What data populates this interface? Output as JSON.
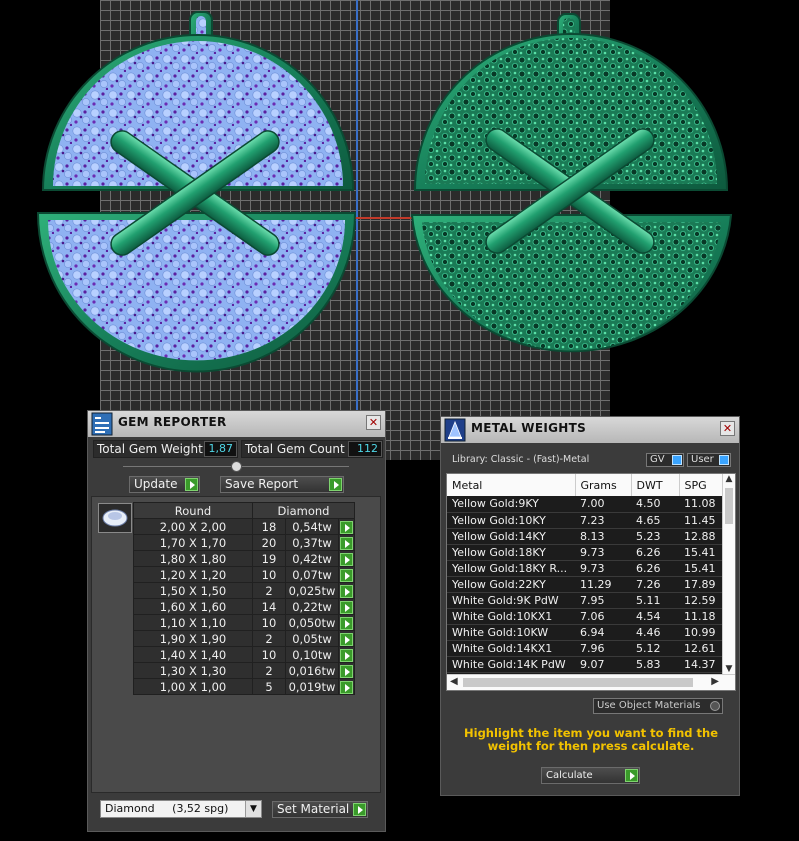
{
  "gem_reporter": {
    "title": "GEM REPORTER",
    "close": "✕",
    "total_gem_weight_label": "Total Gem Weight",
    "total_gem_weight_value": "1,87",
    "total_gem_count_label": "Total Gem Count",
    "total_gem_count_value": "112",
    "update_label": "Update",
    "save_report_label": "Save Report",
    "columns": [
      "Round",
      "Diamond"
    ],
    "rows": [
      {
        "size": "2,00 X 2,00",
        "count": "18",
        "weight": "0,54tw"
      },
      {
        "size": "1,70 X 1,70",
        "count": "20",
        "weight": "0,37tw"
      },
      {
        "size": "1,80 X 1,80",
        "count": "19",
        "weight": "0,42tw"
      },
      {
        "size": "1,20 X 1,20",
        "count": "10",
        "weight": "0,07tw"
      },
      {
        "size": "1,50 X 1,50",
        "count": "2",
        "weight": "0,025tw"
      },
      {
        "size": "1,60 X 1,60",
        "count": "14",
        "weight": "0,22tw"
      },
      {
        "size": "1,10 X 1,10",
        "count": "10",
        "weight": "0,050tw"
      },
      {
        "size": "1,90 X 1,90",
        "count": "2",
        "weight": "0,05tw"
      },
      {
        "size": "1,40 X 1,40",
        "count": "10",
        "weight": "0,10tw"
      },
      {
        "size": "1,30 X 1,30",
        "count": "2",
        "weight": "0,016tw"
      },
      {
        "size": "1,00 X 1,00",
        "count": "5",
        "weight": "0,019tw"
      }
    ],
    "material_select": "Diamond     (3,52 spg)",
    "set_material_label": "Set Material"
  },
  "metal_weights": {
    "title": "METAL WEIGHTS",
    "close": "✕",
    "library_label": "Library: Classic - (Fast)-Metal",
    "gv_label": "GV",
    "user_label": "User",
    "columns": [
      "Metal",
      "Grams",
      "DWT",
      "SPG"
    ],
    "rows": [
      {
        "metal": "Yellow Gold:9KY",
        "grams": "7.00",
        "dwt": "4.50",
        "spg": "11.08"
      },
      {
        "metal": "Yellow Gold:10KY",
        "grams": "7.23",
        "dwt": "4.65",
        "spg": "11.45"
      },
      {
        "metal": "Yellow Gold:14KY",
        "grams": "8.13",
        "dwt": "5.23",
        "spg": "12.88"
      },
      {
        "metal": "Yellow Gold:18KY",
        "grams": "9.73",
        "dwt": "6.26",
        "spg": "15.41"
      },
      {
        "metal": "Yellow Gold:18KY R...",
        "grams": "9.73",
        "dwt": "6.26",
        "spg": "15.41"
      },
      {
        "metal": "Yellow Gold:22KY",
        "grams": "11.29",
        "dwt": "7.26",
        "spg": "17.89"
      },
      {
        "metal": "White Gold:9K PdW",
        "grams": "7.95",
        "dwt": "5.11",
        "spg": "12.59"
      },
      {
        "metal": "White Gold:10KX1",
        "grams": "7.06",
        "dwt": "4.54",
        "spg": "11.18"
      },
      {
        "metal": "White Gold:10KW",
        "grams": "6.94",
        "dwt": "4.46",
        "spg": "10.99"
      },
      {
        "metal": "White Gold:14KX1",
        "grams": "7.96",
        "dwt": "5.12",
        "spg": "12.61"
      },
      {
        "metal": "White Gold:14K PdW",
        "grams": "9.07",
        "dwt": "5.83",
        "spg": "14.37"
      }
    ],
    "use_object_materials_label": "Use Object Materials",
    "hint_text": "Highlight the item you want to find the weight for then press calculate.",
    "calculate_label": "Calculate"
  },
  "colors": {
    "accent_green": "#3a9b2a",
    "value_cyan": "#4fd6e6",
    "hint_yellow": "#f2c200",
    "metal_green": "#1f8a5c",
    "gem_blue": "#8fb6ff",
    "gem_purple": "#6b2bb3"
  }
}
